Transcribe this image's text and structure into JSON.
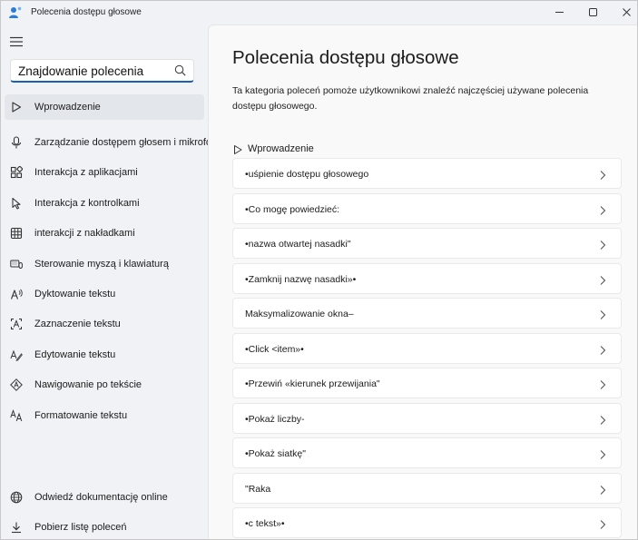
{
  "window": {
    "title": "Polecenia dostępu głosowe"
  },
  "sidebar": {
    "search": {
      "placeholder": "Znajdowanie polecenia",
      "value": ""
    },
    "items": [
      {
        "label": "Wprowadzenie",
        "icon": "play-outline-icon",
        "active": true
      },
      {
        "label": "Zarządzanie dostępem głosem i mikrofonem",
        "icon": "microphone-icon",
        "active": false
      },
      {
        "label": "Interakcja z aplikacjami",
        "icon": "apps-grid-icon",
        "active": false
      },
      {
        "label": "Interakcja z kontrolkami",
        "icon": "cursor-pointer-icon",
        "active": false
      },
      {
        "label": "interakcji z nakładkami",
        "icon": "grid-overlay-icon",
        "active": false
      },
      {
        "label": "Sterowanie myszą i klawiaturą",
        "icon": "keyboard-mouse-icon",
        "active": false
      },
      {
        "label": "Dyktowanie tekstu",
        "icon": "dictation-icon",
        "active": false
      },
      {
        "label": "Zaznaczenie tekstu",
        "icon": "text-select-icon",
        "active": false
      },
      {
        "label": "Edytowanie tekstu",
        "icon": "text-edit-icon",
        "active": false
      },
      {
        "label": "Nawigowanie po tekście",
        "icon": "text-navigate-icon",
        "active": false
      },
      {
        "label": "Formatowanie tekstu",
        "icon": "text-format-icon",
        "active": false
      }
    ],
    "footer": [
      {
        "label": "Odwiedź dokumentację online",
        "icon": "globe-icon"
      },
      {
        "label": "Pobierz listę poleceń",
        "icon": "download-icon"
      }
    ]
  },
  "main": {
    "title": "Polecenia dostępu głosowe",
    "description": "Ta kategoria poleceń pomoże użytkownikowi znaleźć najczęściej używane polecenia dostępu głosowego.",
    "section": {
      "label": "Wprowadzenie",
      "icon": "play-outline-icon"
    },
    "commands": [
      {
        "label": "•uśpienie dostępu głosowego"
      },
      {
        "label": "•Co mogę powiedzieć:"
      },
      {
        "label": "•nazwa otwartej nasadki\""
      },
      {
        "label": "•Zamknij nazwę nasadki»•"
      },
      {
        "label": "Maksymalizowanie okna–"
      },
      {
        "label": "•Click <item»•"
      },
      {
        "label": "•Przewiń «kierunek przewijania\""
      },
      {
        "label": "•Pokaż liczby-"
      },
      {
        "label": "•Pokaż siatkę\""
      },
      {
        "label": "\"Raka"
      },
      {
        "label": "•c tekst»•"
      }
    ]
  },
  "colors": {
    "accent": "#1a5fb4",
    "window_bg": "#f0f2f5",
    "content_bg": "#f9f9f9",
    "card_bg": "#ffffff",
    "active_item_bg": "#e3e6ea"
  }
}
